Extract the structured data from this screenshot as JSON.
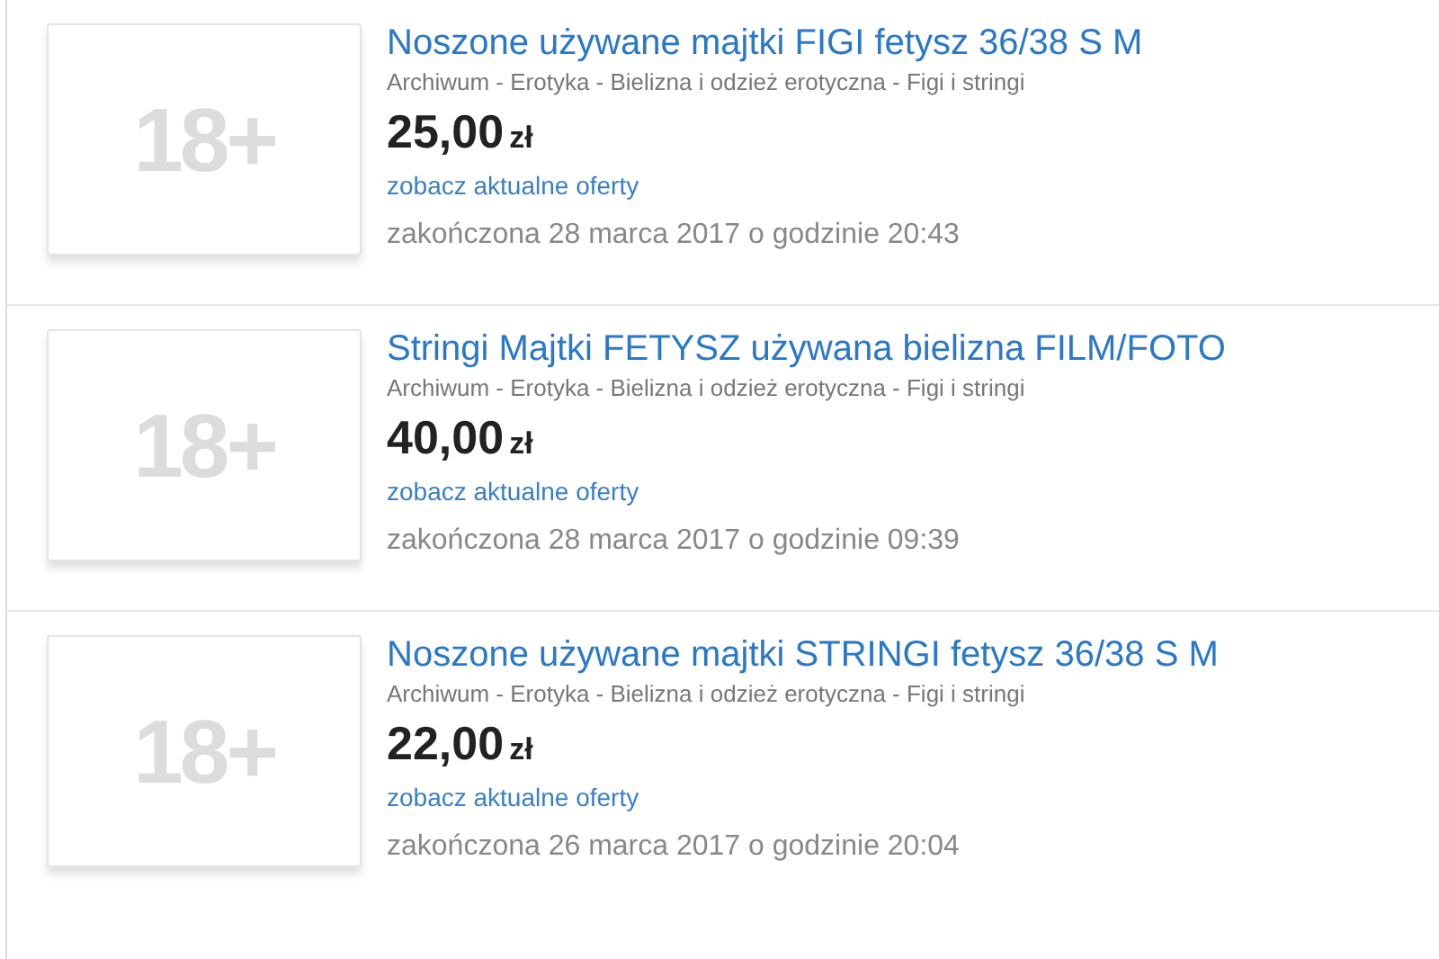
{
  "listings": [
    {
      "thumbnail_label": "18+",
      "title": "Noszone używane majtki FIGI fetysz 36/38 S M",
      "category": "Archiwum - Erotyka - Bielizna i odzież erotyczna - Figi i stringi",
      "price": "25,00",
      "currency": "zł",
      "link": "zobacz aktualne oferty",
      "ended": "zakończona 28 marca 2017 o godzinie 20:43"
    },
    {
      "thumbnail_label": "18+",
      "title": "Stringi Majtki FETYSZ używana bielizna FILM/FOTO",
      "category": "Archiwum - Erotyka - Bielizna i odzież erotyczna - Figi i stringi",
      "price": "40,00",
      "currency": "zł",
      "link": "zobacz aktualne oferty",
      "ended": "zakończona 28 marca 2017 o godzinie 09:39"
    },
    {
      "thumbnail_label": "18+",
      "title": "Noszone używane majtki STRINGI fetysz 36/38 S M",
      "category": "Archiwum - Erotyka - Bielizna i odzież erotyczna - Figi i stringi",
      "price": "22,00",
      "currency": "zł",
      "link": "zobacz aktualne oferty",
      "ended": "zakończona 26 marca 2017 o godzinie 20:04"
    }
  ]
}
